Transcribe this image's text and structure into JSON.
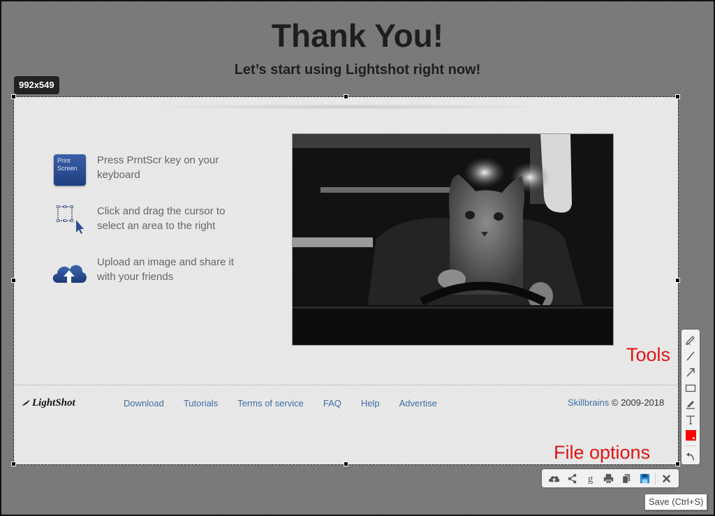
{
  "page": {
    "title": "Thank You!",
    "subtitle": "Let’s start using Lightshot right now!"
  },
  "selection": {
    "size_label": "992x549"
  },
  "steps": [
    {
      "icon": "print-screen-key-icon",
      "key_text": "Print Screen",
      "text": "Press PrntScr key on your keyboard"
    },
    {
      "icon": "select-area-cursor-icon",
      "text": "Click and drag the cursor to select an area to the right"
    },
    {
      "icon": "cloud-upload-icon",
      "text": "Upload an image and share it with your friends"
    }
  ],
  "photo": {
    "alt": "Cat sitting behind a steering wheel (black & white)"
  },
  "footer": {
    "logo": "LightShot",
    "links": [
      "Download",
      "Tutorials",
      "Terms of service",
      "FAQ",
      "Help",
      "Advertise"
    ],
    "company": "Skillbrains",
    "copyright": "© 2009-2018"
  },
  "annotations": {
    "tools_label": "Tools",
    "file_options_label": "File options",
    "color": "#e31414"
  },
  "tools_panel": {
    "items": [
      "pen-icon",
      "line-icon",
      "arrow-icon",
      "rectangle-icon",
      "marker-icon",
      "text-icon",
      "color-picker",
      "undo-icon"
    ],
    "current_color": "#ff0000"
  },
  "file_options_panel": {
    "items": [
      "upload-cloud-icon",
      "share-icon",
      "google-search-icon",
      "print-icon",
      "copy-icon",
      "save-icon",
      "close-icon"
    ],
    "active": "save-icon",
    "active_color": "#2a8ad4"
  },
  "tooltip": {
    "text": "Save (Ctrl+S)"
  }
}
